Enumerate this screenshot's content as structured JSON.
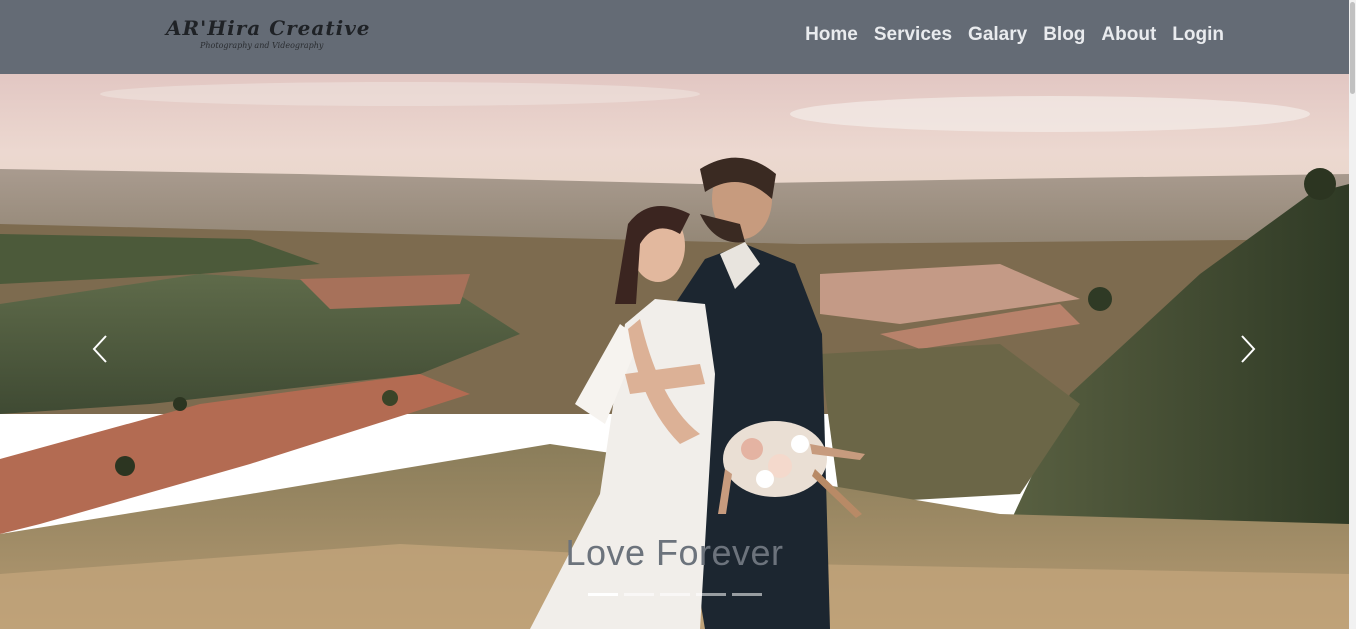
{
  "brand": {
    "title": "AR'Hira Creative",
    "subtitle": "Photography and Videography"
  },
  "nav": {
    "items": [
      {
        "label": "Home"
      },
      {
        "label": "Services"
      },
      {
        "label": "Galary"
      },
      {
        "label": "Blog"
      },
      {
        "label": "About"
      },
      {
        "label": "Login"
      }
    ]
  },
  "carousel": {
    "caption": "Love Forever",
    "prev_icon": "chevron-left-icon",
    "next_icon": "chevron-right-icon",
    "slide_count": 5,
    "active_slide": 1
  },
  "colors": {
    "navbar_bg": "#646b75",
    "nav_text": "#e9ebee",
    "caption_text": "#6c737c"
  }
}
